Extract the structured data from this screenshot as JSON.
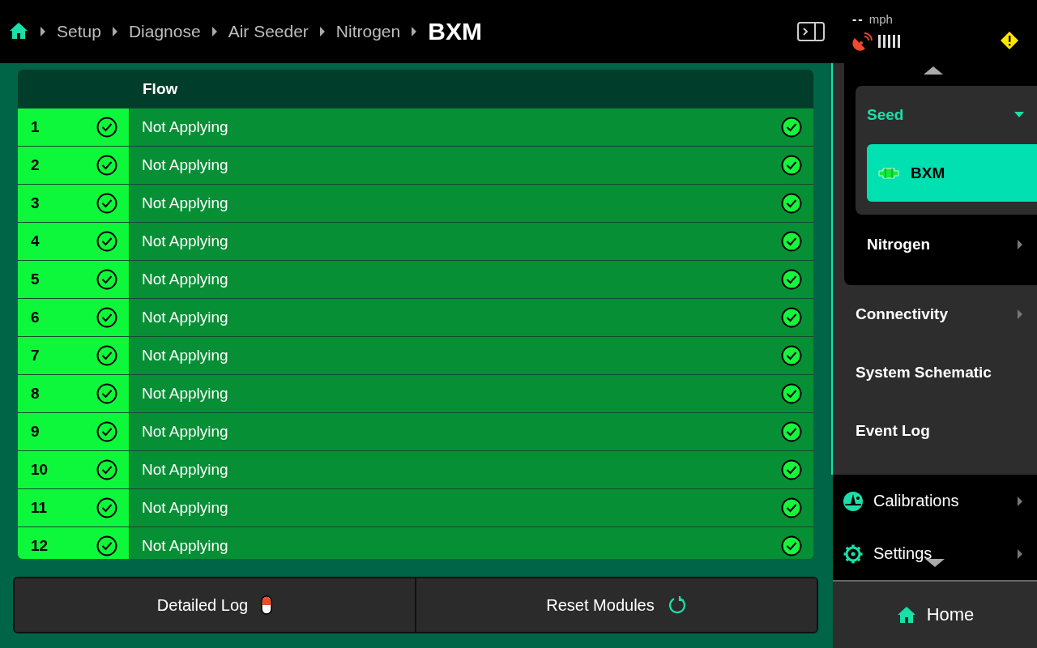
{
  "breadcrumb": [
    {
      "label": "Setup"
    },
    {
      "label": "Diagnose"
    },
    {
      "label": "Air Seeder"
    },
    {
      "label": "Nitrogen"
    }
  ],
  "title": "BXM",
  "status": {
    "speed": "--",
    "unit": "mph",
    "gps_ok": false,
    "warning": true
  },
  "table": {
    "columns": [
      "Flow"
    ],
    "rows": [
      {
        "number": "1",
        "module_ok": true,
        "flow": "Not Applying",
        "flow_ok": true
      },
      {
        "number": "2",
        "module_ok": true,
        "flow": "Not Applying",
        "flow_ok": true
      },
      {
        "number": "3",
        "module_ok": true,
        "flow": "Not Applying",
        "flow_ok": true
      },
      {
        "number": "4",
        "module_ok": true,
        "flow": "Not Applying",
        "flow_ok": true
      },
      {
        "number": "5",
        "module_ok": true,
        "flow": "Not Applying",
        "flow_ok": true
      },
      {
        "number": "6",
        "module_ok": true,
        "flow": "Not Applying",
        "flow_ok": true
      },
      {
        "number": "7",
        "module_ok": true,
        "flow": "Not Applying",
        "flow_ok": true
      },
      {
        "number": "8",
        "module_ok": true,
        "flow": "Not Applying",
        "flow_ok": true
      },
      {
        "number": "9",
        "module_ok": true,
        "flow": "Not Applying",
        "flow_ok": true
      },
      {
        "number": "10",
        "module_ok": true,
        "flow": "Not Applying",
        "flow_ok": true
      },
      {
        "number": "11",
        "module_ok": true,
        "flow": "Not Applying",
        "flow_ok": true
      },
      {
        "number": "12",
        "module_ok": true,
        "flow": "Not Applying",
        "flow_ok": true
      }
    ]
  },
  "buttons": [
    {
      "label": "Detailed Log",
      "kind": "log"
    },
    {
      "label": "Reset Modules",
      "kind": "reset"
    }
  ],
  "nav": {
    "group": {
      "label": "Seed",
      "expanded": true,
      "children": [
        {
          "label": "BXM",
          "selected": true
        }
      ]
    },
    "inner_items": [
      {
        "label": "Nitrogen",
        "has_submenu": true
      }
    ],
    "items": [
      {
        "label": "Connectivity",
        "has_submenu": true
      },
      {
        "label": "System Schematic",
        "has_submenu": false
      },
      {
        "label": "Event Log",
        "has_submenu": false
      }
    ],
    "tools": [
      {
        "label": "Calibrations",
        "kind": "calibrations",
        "has_submenu": true
      },
      {
        "label": "Settings",
        "kind": "settings",
        "has_submenu": true
      }
    ],
    "home": {
      "label": "Home"
    }
  }
}
